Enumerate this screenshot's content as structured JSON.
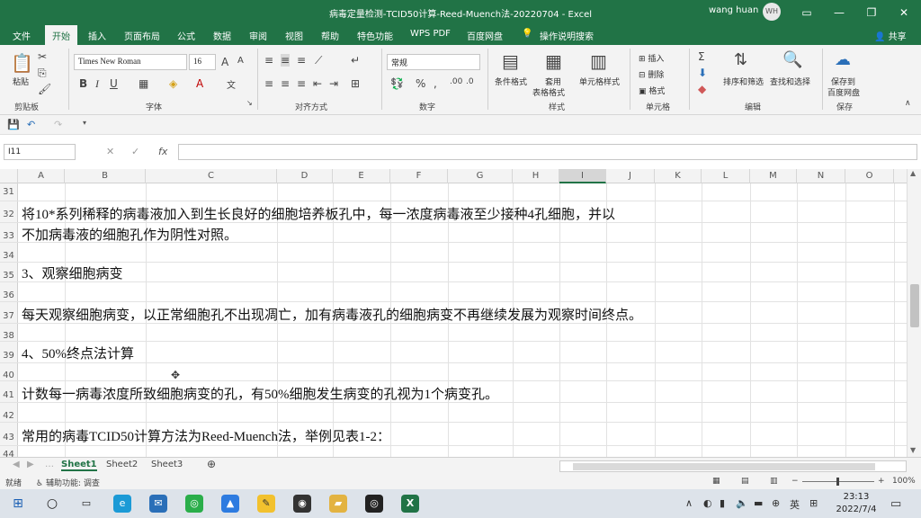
{
  "window": {
    "title": "病毒定量检测-TCID50计算-Reed-Muench法-20220704 - Excel",
    "user": "wang huan",
    "avatar": "WH"
  },
  "menu": [
    "文件",
    "开始",
    "插入",
    "页面布局",
    "公式",
    "数据",
    "审阅",
    "视图",
    "帮助",
    "特色功能",
    "WPS PDF",
    "百度网盘",
    "操作说明搜索"
  ],
  "share": "共享",
  "ribbon": {
    "paste": "粘贴",
    "font_name": "Times New Roman",
    "font_size": "16",
    "number_format": "常规",
    "cond_format": "条件格式",
    "table_format_1": "套用",
    "table_format_2": "表格格式",
    "cell_style": "单元格样式",
    "insert": "插入",
    "delete": "删除",
    "format": "格式",
    "sort_filter": "排序和筛选",
    "find_select": "查找和选择",
    "save_to_1": "保存到",
    "save_to_2": "百度网盘",
    "groups": [
      "剪贴板",
      "字体",
      "对齐方式",
      "数字",
      "样式",
      "单元格",
      "编辑",
      "保存"
    ]
  },
  "namebox": "I11",
  "columns": [
    "A",
    "B",
    "C",
    "D",
    "E",
    "F",
    "G",
    "H",
    "I",
    "J",
    "K",
    "L",
    "M",
    "N",
    "O"
  ],
  "rows": [
    {
      "n": "31",
      "text": ""
    },
    {
      "n": "32",
      "text": "将10*系列稀释的病毒液加入到生长良好的细胞培养板孔中，每一浓度病毒液至少接种4孔细胞，并以"
    },
    {
      "n": "33",
      "text": "不加病毒液的细胞孔作为阴性对照。"
    },
    {
      "n": "34",
      "text": ""
    },
    {
      "n": "35",
      "text": "3、观察细胞病变"
    },
    {
      "n": "36",
      "text": ""
    },
    {
      "n": "37",
      "text": "每天观察细胞病变，以正常细胞孔不出现凋亡，加有病毒液孔的细胞病变不再继续发展为观察时间终点。"
    },
    {
      "n": "38",
      "text": ""
    },
    {
      "n": "39",
      "text": "4、50%终点法计算"
    },
    {
      "n": "40",
      "text": ""
    },
    {
      "n": "41",
      "text": "计数每一病毒浓度所致细胞病变的孔，有50%细胞发生病变的孔视为1个病变孔。"
    },
    {
      "n": "42",
      "text": ""
    },
    {
      "n": "43",
      "text": "常用的病毒TCID50计算方法为Reed-Muench法，举例见表1-2："
    },
    {
      "n": "44",
      "text": ""
    }
  ],
  "sheets": [
    "Sheet1",
    "Sheet2",
    "Sheet3"
  ],
  "status": {
    "ready": "就绪",
    "accessibility": "辅助功能: 调查",
    "zoom": "100%"
  },
  "taskbar": {
    "time": "23:13",
    "date": "2022/7/4",
    "lang": "英"
  }
}
